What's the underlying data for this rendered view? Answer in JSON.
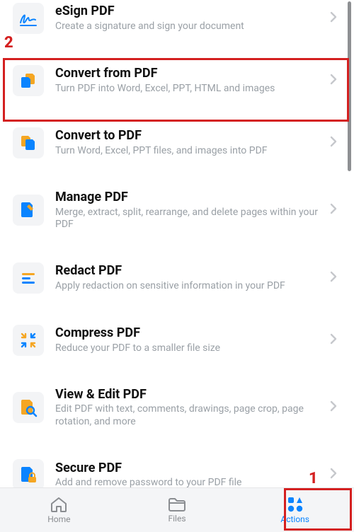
{
  "annotations": {
    "label1": "1",
    "label2": "2"
  },
  "items": [
    {
      "title": "eSign PDF",
      "subtitle": "Create a signature and sign your document",
      "icon": "esign"
    },
    {
      "title": "Convert from PDF",
      "subtitle": "Turn PDF into Word, Excel, PPT, HTML and images",
      "icon": "convert-from"
    },
    {
      "title": "Convert to PDF",
      "subtitle": "Turn Word, Excel, PPT files, and images into PDF",
      "icon": "convert-to"
    },
    {
      "title": "Manage PDF",
      "subtitle": "Merge, extract, split, rearrange, and delete pages within your PDF",
      "icon": "manage"
    },
    {
      "title": "Redact PDF",
      "subtitle": "Apply redaction on sensitive information in your PDF",
      "icon": "redact"
    },
    {
      "title": "Compress PDF",
      "subtitle": "Reduce your PDF to a smaller file size",
      "icon": "compress"
    },
    {
      "title": "View & Edit PDF",
      "subtitle": "Edit PDF with text, comments, drawings, page crop, page rotation, and more",
      "icon": "view-edit"
    },
    {
      "title": "Secure PDF",
      "subtitle": "Add and remove password to your PDF file",
      "icon": "secure"
    }
  ],
  "tabs": {
    "home": "Home",
    "files": "Files",
    "actions": "Actions"
  }
}
